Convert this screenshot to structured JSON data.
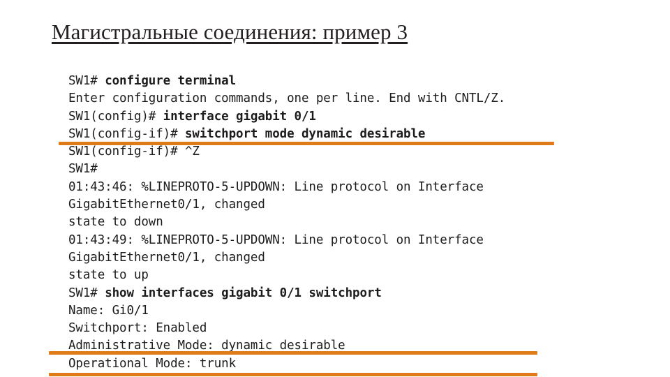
{
  "slide": {
    "title": "Магистральные соединения: пример 3",
    "accent_color": "#e07b1a",
    "text_color": "#1c1c1c"
  },
  "terminal": {
    "lines": [
      {
        "prompt": "SW1# ",
        "command": "configure terminal"
      },
      {
        "prompt": "Enter configuration commands, one per line. End with CNTL/Z.",
        "command": ""
      },
      {
        "prompt": "SW1(config)# ",
        "command": "interface gigabit 0/1"
      },
      {
        "prompt": "SW1(config-if)# ",
        "command": "switchport mode dynamic desirable"
      },
      {
        "prompt": "SW1(config-if)# ^Z",
        "command": ""
      },
      {
        "prompt": "SW1#",
        "command": ""
      },
      {
        "prompt": "01:43:46: %LINEPROTO-5-UPDOWN: Line protocol on Interface",
        "command": ""
      },
      {
        "prompt": "GigabitEthernet0/1, changed",
        "command": ""
      },
      {
        "prompt": "state to down",
        "command": ""
      },
      {
        "prompt": "01:43:49: %LINEPROTO-5-UPDOWN: Line protocol on Interface",
        "command": ""
      },
      {
        "prompt": "GigabitEthernet0/1, changed",
        "command": ""
      },
      {
        "prompt": "state to up",
        "command": ""
      },
      {
        "prompt": "SW1# ",
        "command": "show interfaces gigabit 0/1 switchport"
      },
      {
        "prompt": "Name: Gi0/1",
        "command": ""
      },
      {
        "prompt": "Switchport: Enabled",
        "command": ""
      },
      {
        "prompt": "Administrative Mode: dynamic desirable",
        "command": ""
      },
      {
        "prompt": "Operational Mode: trunk",
        "command": ""
      }
    ]
  },
  "highlights": [
    {
      "name": "highlight-switchport-mode"
    },
    {
      "name": "highlight-administrative-mode"
    },
    {
      "name": "highlight-operational-mode"
    }
  ]
}
